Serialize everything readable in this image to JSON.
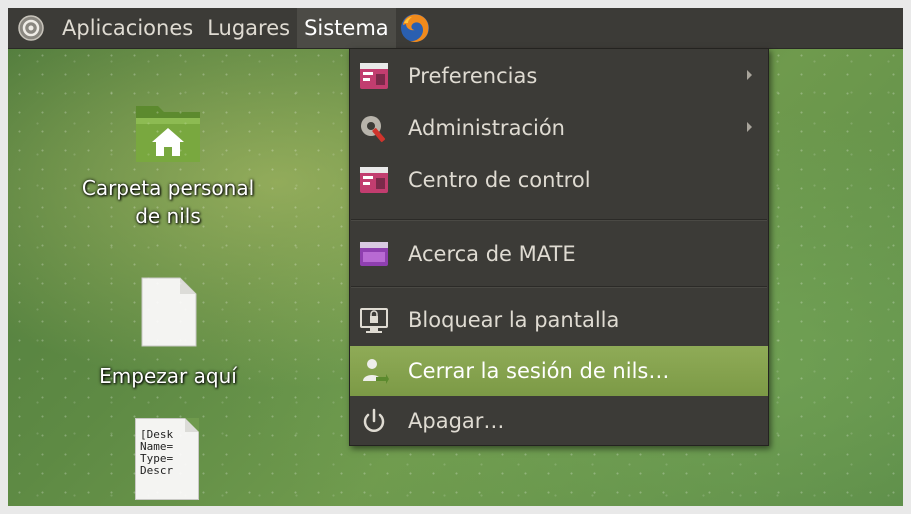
{
  "panel": {
    "menus": [
      "Aplicaciones",
      "Lugares",
      "Sistema"
    ],
    "logo_icon": "mate-logo-icon",
    "launcher_icon": "firefox-icon"
  },
  "desktop": {
    "icons": [
      {
        "label_line1": "Carpeta personal",
        "label_line2": "de nils",
        "icon": "home-folder-icon"
      },
      {
        "label": "Empezar aquí",
        "icon": "text-file-icon"
      },
      {
        "preview_lines": [
          "[Desk",
          "Name=",
          "Type=",
          "Descr"
        ],
        "icon": "desktop-entry-file-icon"
      }
    ]
  },
  "system_menu": {
    "items": [
      {
        "label": "Preferencias",
        "icon": "preferences-icon",
        "submenu": true
      },
      {
        "label": "Administración",
        "icon": "administration-icon",
        "submenu": true
      },
      {
        "label": "Centro de control",
        "icon": "control-center-icon",
        "submenu": false
      },
      {
        "label": "Acerca de MATE",
        "icon": "about-mate-icon",
        "submenu": false
      },
      {
        "label": "Bloquear la pantalla",
        "icon": "lock-screen-icon",
        "submenu": false
      },
      {
        "label": "Cerrar la sesión de nils…",
        "icon": "logout-user-icon",
        "submenu": false,
        "highlighted": true
      },
      {
        "label": "Apagar…",
        "icon": "power-icon",
        "submenu": false
      }
    ]
  },
  "colors": {
    "panel_bg": "#3c3b37",
    "menu_highlight": "#87a34f",
    "menu_text": "#dfdbd2"
  }
}
